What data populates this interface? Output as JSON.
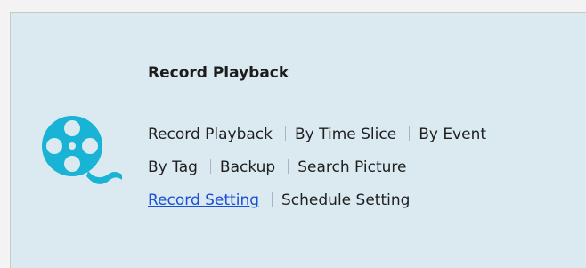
{
  "section": {
    "title": "Record Playback",
    "icon": "film-reel-icon",
    "accent": "#19b3d6",
    "rows": [
      [
        {
          "label": "Record Playback"
        },
        {
          "label": "By Time Slice"
        },
        {
          "label": "By Event"
        }
      ],
      [
        {
          "label": "By Tag"
        },
        {
          "label": "Backup"
        },
        {
          "label": "Search Picture"
        }
      ],
      [
        {
          "label": "Record Setting",
          "active": true
        },
        {
          "label": "Schedule Setting"
        }
      ]
    ]
  }
}
